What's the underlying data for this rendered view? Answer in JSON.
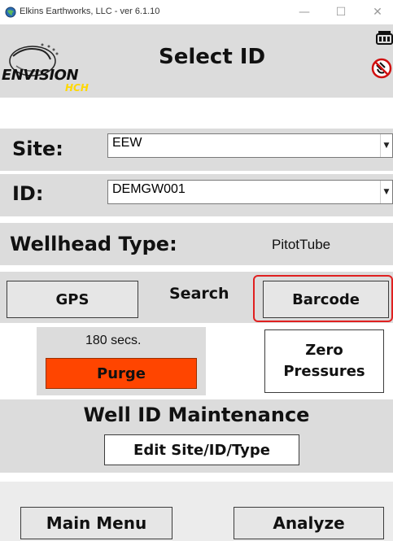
{
  "window": {
    "title": "Elkins Earthworks, LLC - ver 6.1.10",
    "minimize": "—",
    "maximize": "☐",
    "close": "✕"
  },
  "header": {
    "logo_main": "ENVISION",
    "logo_sub": "HCH",
    "title": "Select ID"
  },
  "site": {
    "label": "Site:",
    "value": "EEW"
  },
  "id": {
    "label": "ID:",
    "value": "DEMGW001"
  },
  "wellhead": {
    "label": "Wellhead Type:",
    "value": "PitotTube"
  },
  "search": {
    "gps_label": "GPS",
    "search_label": "Search",
    "barcode_label": "Barcode"
  },
  "purge": {
    "time_text": "180 secs.",
    "button_label": "Purge"
  },
  "zero_pressures": {
    "line1": "Zero",
    "line2": "Pressures"
  },
  "maintenance": {
    "title": "Well ID Maintenance",
    "edit_label": "Edit Site/ID/Type"
  },
  "footer": {
    "main_menu_label": "Main Menu",
    "analyze_label": "Analyze"
  },
  "colors": {
    "panel_grey": "#dcdcdc",
    "purge_orange": "#ff4500",
    "highlight_red": "#e02020",
    "logo_yellow": "#ffd800"
  }
}
